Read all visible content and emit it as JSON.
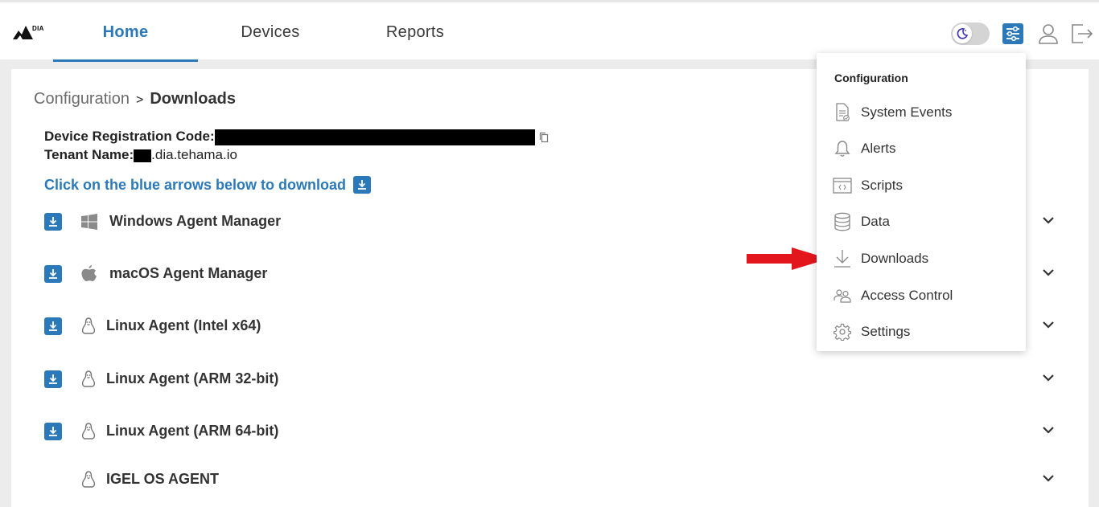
{
  "brand": {
    "logo_text": "DIA"
  },
  "nav": {
    "tabs": [
      {
        "label": "Home",
        "active": true
      },
      {
        "label": "Devices",
        "active": false
      },
      {
        "label": "Reports",
        "active": false
      }
    ]
  },
  "header_icons": [
    "theme-toggle-icon",
    "settings-sliders-icon",
    "user-icon",
    "logout-icon"
  ],
  "breadcrumb": {
    "parent": "Configuration",
    "separator": ">",
    "current": "Downloads"
  },
  "info": {
    "registration_label": "Device Registration Code:",
    "tenant_label": "Tenant Name:",
    "tenant_suffix": ".dia.tehama.io"
  },
  "download_hint": "Click on the blue arrows below to download",
  "agents": [
    {
      "name": "Windows Agent Manager",
      "os": "windows-icon",
      "downloadable": true
    },
    {
      "name": "macOS Agent Manager",
      "os": "apple-icon",
      "downloadable": true
    },
    {
      "name": "Linux Agent (Intel x64)",
      "os": "linux-icon",
      "downloadable": true
    },
    {
      "name": "Linux Agent (ARM 32-bit)",
      "os": "linux-icon",
      "downloadable": true
    },
    {
      "name": "Linux Agent (ARM 64-bit)",
      "os": "linux-icon",
      "downloadable": true
    },
    {
      "name": "IGEL OS AGENT",
      "os": "linux-icon",
      "downloadable": false
    }
  ],
  "menu": {
    "heading": "Configuration",
    "items": [
      {
        "label": "System Events",
        "icon": "document-icon"
      },
      {
        "label": "Alerts",
        "icon": "bell-icon"
      },
      {
        "label": "Scripts",
        "icon": "script-window-icon"
      },
      {
        "label": "Data",
        "icon": "database-icon"
      },
      {
        "label": "Downloads",
        "icon": "download-icon"
      },
      {
        "label": "Access Control",
        "icon": "users-icon"
      },
      {
        "label": "Settings",
        "icon": "gear-icon"
      }
    ]
  },
  "colors": {
    "accent": "#2b79b9",
    "annotation_arrow": "#e3161d",
    "redaction": "#000000"
  }
}
